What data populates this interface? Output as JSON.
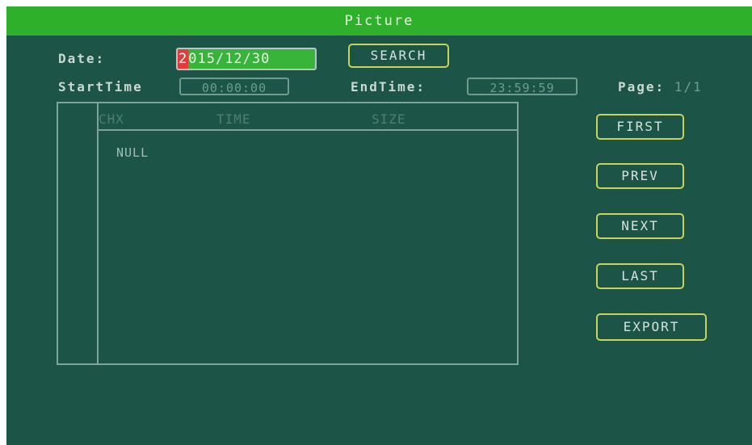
{
  "window": {
    "title": "Picture"
  },
  "search": {
    "date_label": "Date:",
    "date_value_cursor": "2",
    "date_value_rest": "015/12/30",
    "search_button": "SEARCH",
    "start_label": "StartTime",
    "start_value": "00:00:00",
    "end_label": "EndTime:",
    "end_value": "23:59:59",
    "page_label": "Page:",
    "page_value": "1/1"
  },
  "table": {
    "columns": [
      "CHX",
      "TIME",
      "SIZE"
    ],
    "rows": [
      "NULL"
    ]
  },
  "nav": {
    "first": "FIRST",
    "prev": "PREV",
    "next": "NEXT",
    "last": "LAST",
    "export": "EXPORT"
  },
  "colors": {
    "background": "#1c5448",
    "title_bar": "#2fb02a",
    "date_field": "#38b43a",
    "cursor": "#e23b3b",
    "button_border": "#c8d35a"
  }
}
